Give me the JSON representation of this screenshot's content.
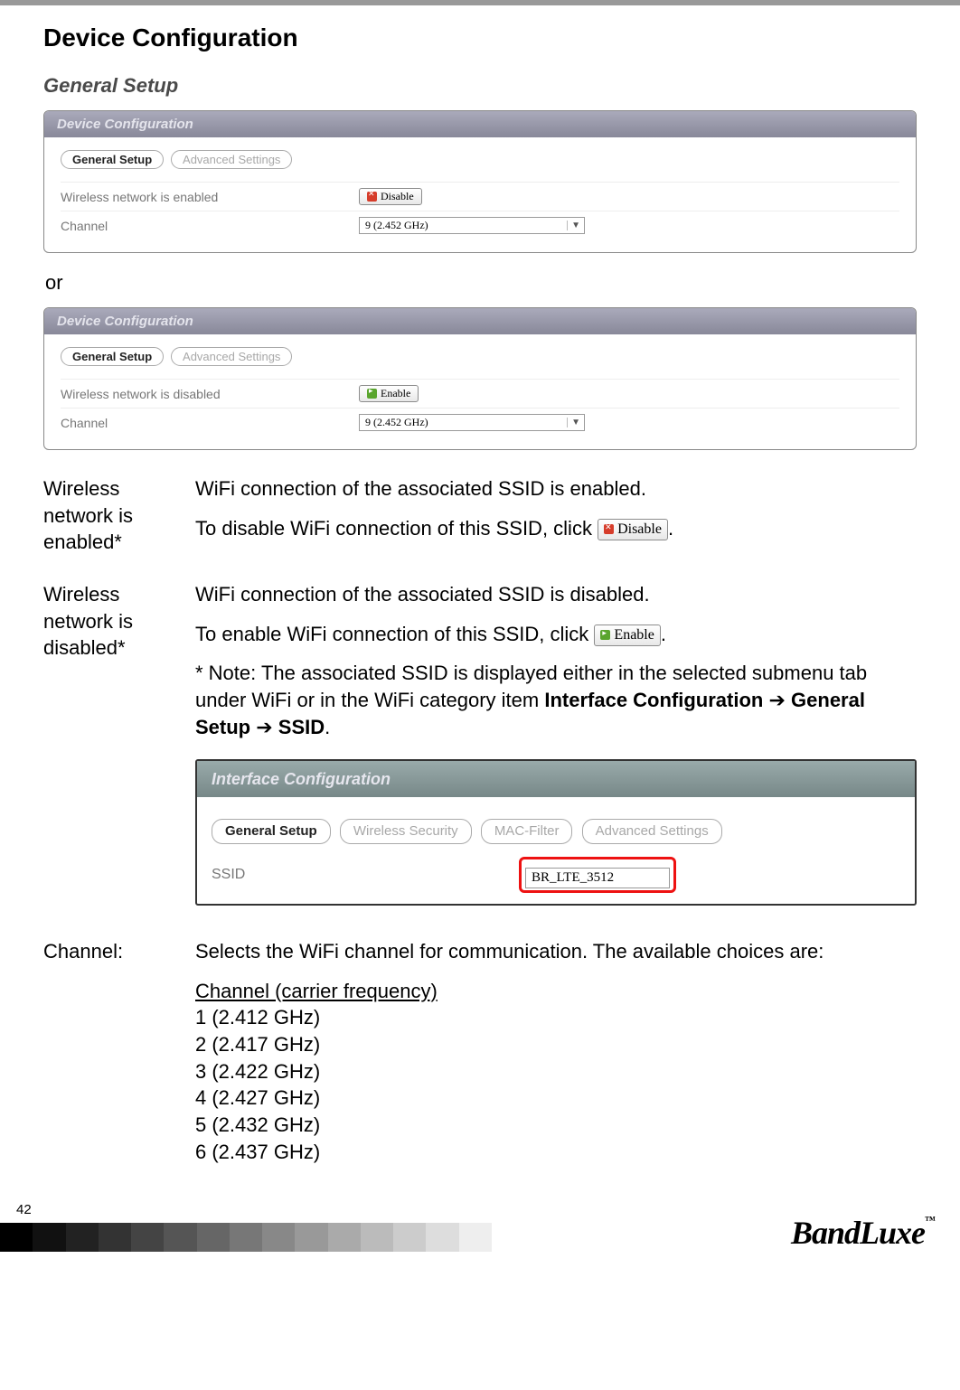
{
  "page": {
    "title": "Device Configuration",
    "subhead": "General Setup",
    "or_text": "or",
    "page_number": "42",
    "brand": "BandLuxe",
    "brand_tm": "™"
  },
  "panel1": {
    "header": "Device Configuration",
    "tabs": {
      "active": "General Setup",
      "inactive": "Advanced Settings"
    },
    "row1_label": "Wireless network is enabled",
    "row1_btn": "Disable",
    "row2_label": "Channel",
    "row2_value": "9 (2.452 GHz)"
  },
  "panel2": {
    "header": "Device Configuration",
    "tabs": {
      "active": "General Setup",
      "inactive": "Advanced Settings"
    },
    "row1_label": "Wireless network is disabled",
    "row1_btn": "Enable",
    "row2_label": "Channel",
    "row2_value": "9 (2.452 GHz)"
  },
  "desc_enabled": {
    "left": "Wireless network is enabled*",
    "p1": "WiFi connection of the associated SSID is enabled.",
    "p2_pre": "To disable WiFi connection of this SSID, click ",
    "p2_btn": "Disable",
    "p2_post": "."
  },
  "desc_disabled": {
    "left": "Wireless network is disabled*",
    "p1": "WiFi connection of the associated SSID is disabled.",
    "p2_pre": "To enable WiFi connection of this SSID, click ",
    "p2_btn": "Enable",
    "p2_post": ".",
    "note_pre": "* Note: The associated SSID is displayed either in the selected submenu tab under WiFi or in the WiFi category item ",
    "b1": "Interface Configuration",
    "arrow": " ➔ ",
    "b2": "General Setup",
    "b3": "SSID",
    "note_post": "."
  },
  "iface": {
    "header": "Interface Configuration",
    "tabs": [
      "General Setup",
      "Wireless Security",
      "MAC-Filter",
      "Advanced Settings"
    ],
    "ssid_label": "SSID",
    "ssid_value": "BR_LTE_3512"
  },
  "channel_section": {
    "label": "Channel:",
    "desc": "Selects the WiFi channel for communication. The available choices are:",
    "list_head": "Channel (carrier frequency)",
    "items": [
      "1 (2.412 GHz)",
      "2 (2.417 GHz)",
      "3 (2.422 GHz)",
      "4 (2.427 GHz)",
      "5 (2.432 GHz)",
      "6 (2.437 GHz)"
    ]
  }
}
